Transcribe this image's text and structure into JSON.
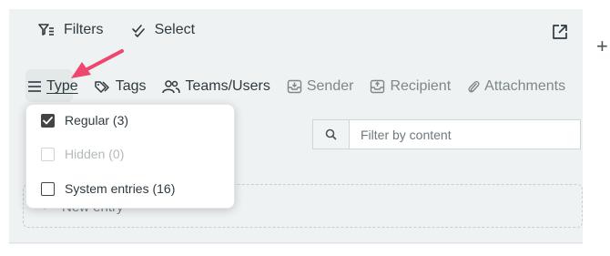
{
  "toolbar": {
    "filters_label": "Filters",
    "select_label": "Select"
  },
  "tabs": [
    {
      "label": "Type"
    },
    {
      "label": "Tags"
    },
    {
      "label": "Teams/Users"
    },
    {
      "label": "Sender"
    },
    {
      "label": "Recipient"
    },
    {
      "label": "Attachments"
    }
  ],
  "search": {
    "placeholder": "Filter by content"
  },
  "new_entry": {
    "label": "New entry"
  },
  "type_dropdown": {
    "options": [
      {
        "label": "Regular (3)",
        "checked": true,
        "disabled": false
      },
      {
        "label": "Hidden (0)",
        "checked": false,
        "disabled": true
      },
      {
        "label": "System entries (16)",
        "checked": false,
        "disabled": false
      }
    ]
  },
  "colors": {
    "annotation_arrow": "#f0456e",
    "panel_bg": "#eef2f2",
    "text": "#2f3a40",
    "muted_text": "#7d878c"
  }
}
